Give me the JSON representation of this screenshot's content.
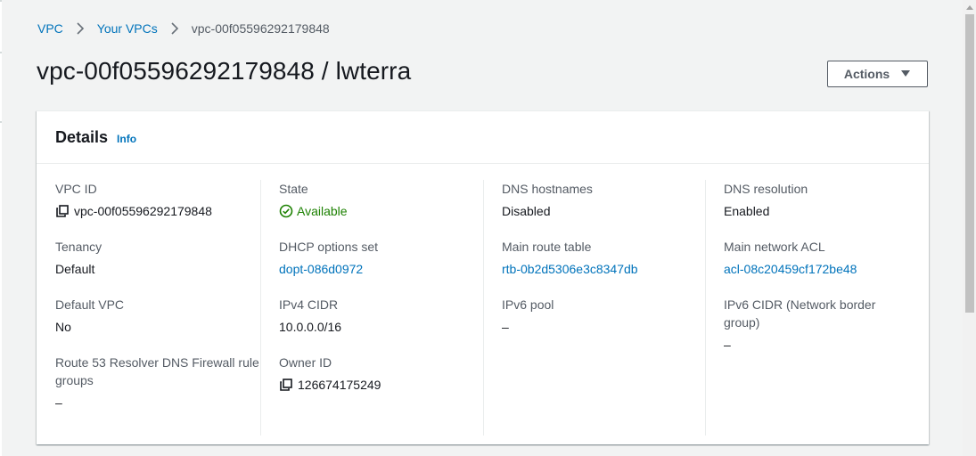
{
  "breadcrumb": {
    "items": [
      "VPC",
      "Your VPCs"
    ],
    "current": "vpc-00f05596292179848"
  },
  "page": {
    "title": "vpc-00f05596292179848 / lwterra",
    "actions_label": "Actions"
  },
  "details": {
    "title": "Details",
    "info_label": "Info",
    "columns": [
      [
        {
          "label": "VPC ID",
          "value": "vpc-00f05596292179848"
        },
        {
          "label": "Tenancy",
          "value": "Default"
        },
        {
          "label": "Default VPC",
          "value": "No"
        },
        {
          "label": "Route 53 Resolver DNS Firewall rule groups",
          "value": "–"
        }
      ],
      [
        {
          "label": "State",
          "value": "Available"
        },
        {
          "label": "DHCP options set",
          "value": "dopt-086d0972"
        },
        {
          "label": "IPv4 CIDR",
          "value": "10.0.0.0/16"
        },
        {
          "label": "Owner ID",
          "value": "126674175249"
        }
      ],
      [
        {
          "label": "DNS hostnames",
          "value": "Disabled"
        },
        {
          "label": "Main route table",
          "value": "rtb-0b2d5306e3c8347db"
        },
        {
          "label": "IPv6 pool",
          "value": "–"
        }
      ],
      [
        {
          "label": "DNS resolution",
          "value": "Enabled"
        },
        {
          "label": "Main network ACL",
          "value": "acl-08c20459cf172be48"
        },
        {
          "label": "IPv6 CIDR (Network border group)",
          "value": "–"
        }
      ]
    ]
  },
  "colors": {
    "link": "#0073bb",
    "success": "#1d8102",
    "text": "#16191f",
    "muted": "#545b64",
    "background": "#f2f3f3"
  },
  "icons": {
    "breadcrumb_separator": "chevron-right-icon",
    "actions_caret": "caret-down-icon",
    "copy": "copy-icon",
    "state": "check-circle-icon"
  }
}
